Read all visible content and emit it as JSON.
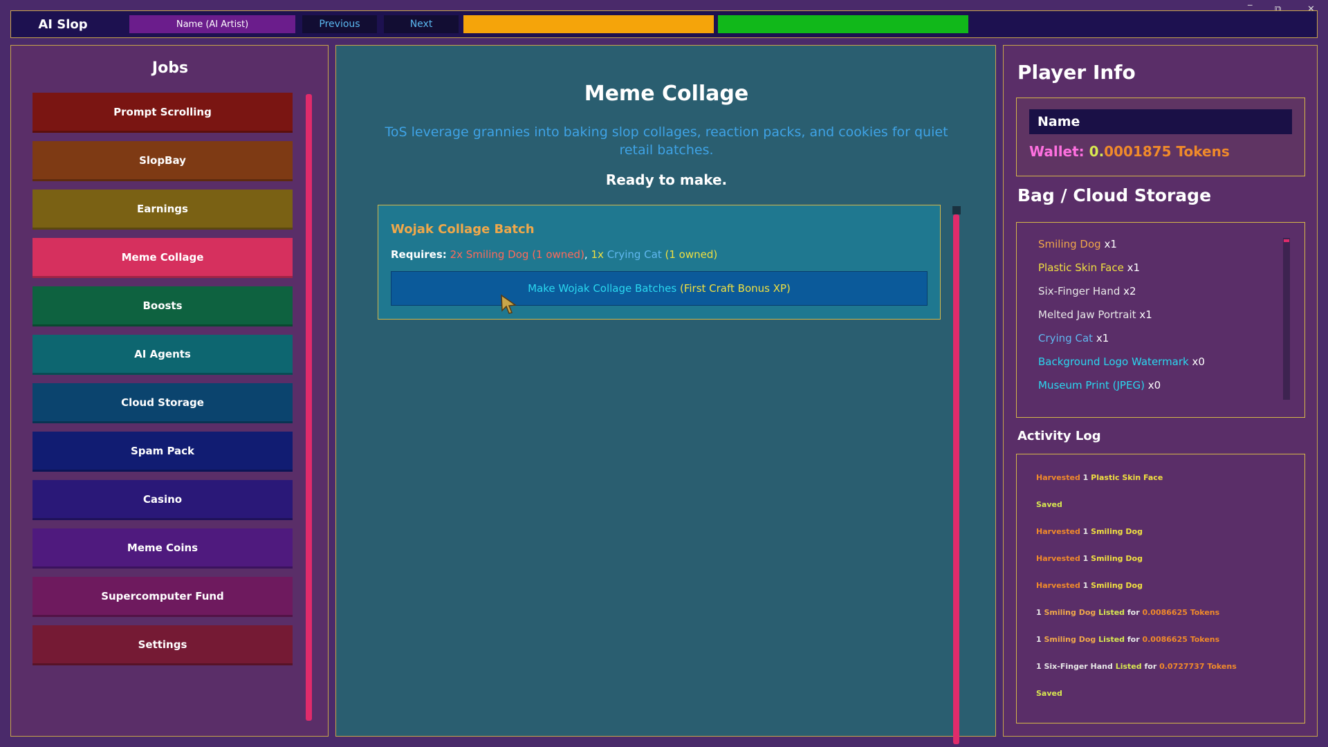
{
  "app": {
    "title": "AI Slop"
  },
  "topbar": {
    "name_tab": "Name (AI Artist)",
    "previous": "Previous",
    "next": "Next",
    "orange_bar_color": "#f5a40a",
    "green_bar_color": "#11b81a"
  },
  "window_controls": {
    "restore": "⧉",
    "close": "✕",
    "minimize": "‾"
  },
  "jobs": {
    "title": "Jobs",
    "items": [
      {
        "label": "Prompt Scrolling",
        "color": "#7a1512"
      },
      {
        "label": "SlopBay",
        "color": "#7e3a14"
      },
      {
        "label": "Earnings",
        "color": "#7a6114"
      },
      {
        "label": "Meme Collage",
        "color": "#d6305e"
      },
      {
        "label": "Boosts",
        "color": "#0e6240"
      },
      {
        "label": "AI Agents",
        "color": "#0d6670"
      },
      {
        "label": "Cloud Storage",
        "color": "#0b446e"
      },
      {
        "label": "Spam Pack",
        "color": "#111c72"
      },
      {
        "label": "Casino",
        "color": "#2a1878"
      },
      {
        "label": "Meme Coins",
        "color": "#4f1a7e"
      },
      {
        "label": "Supercomputer Fund",
        "color": "#6e1a5e"
      },
      {
        "label": "Settings",
        "color": "#751a34"
      }
    ]
  },
  "main": {
    "title": "Meme Collage",
    "description": "ToS leverage grannies into baking slop collages, reaction packs, and cookies for quiet retail batches.",
    "status": "Ready to make.",
    "recipe": {
      "title": "Wojak Collage Batch",
      "requires_label": "Requires:",
      "req1": "2x Smiling Dog (1 owned)",
      "sep": ",",
      "req2_qty": "1x",
      "req2_name": "Crying Cat",
      "req2_owned": "(1 owned)",
      "button_main": "Make Wojak Collage Batches",
      "button_bonus": "(First Craft Bonus XP)"
    }
  },
  "player": {
    "title": "Player Info",
    "name": "Name",
    "wallet_label": "Wallet:",
    "wallet_value": "0.",
    "wallet_amount": "0001875 Tokens"
  },
  "bag": {
    "title": "Bag / Cloud Storage",
    "items": [
      {
        "name": "Smiling Dog",
        "qty": "x1",
        "color": "#f0a84a"
      },
      {
        "name": "Plastic Skin Face",
        "qty": "x1",
        "color": "#f0e040"
      },
      {
        "name": "Six-Finger Hand",
        "qty": "x2",
        "color": "#e8e8e8"
      },
      {
        "name": "Melted Jaw Portrait",
        "qty": "x1",
        "color": "#e8e8e8"
      },
      {
        "name": "Crying Cat",
        "qty": "x1",
        "color": "#60b8f0"
      },
      {
        "name": "Background Logo Watermark",
        "qty": "x0",
        "color": "#2ad8f0"
      },
      {
        "name": "Museum Print (JPEG)",
        "qty": "x0",
        "color": "#2ad8f0"
      }
    ]
  },
  "log": {
    "title": "Activity Log",
    "lines": [
      {
        "a": "Harvested",
        "b": " 1 ",
        "c": "Plastic Skin Face",
        "type": "harvest"
      },
      {
        "a": "Saved",
        "type": "saved"
      },
      {
        "a": "Harvested",
        "b": " 1 ",
        "c": "Smiling Dog",
        "type": "harvest"
      },
      {
        "a": "Harvested",
        "b": " 1 ",
        "c": "Smiling Dog",
        "type": "harvest"
      },
      {
        "a": "Harvested",
        "b": " 1 ",
        "c": "Smiling Dog",
        "type": "harvest"
      },
      {
        "a": "1 ",
        "b": "Smiling Dog",
        "c": " Listed",
        "d": " for ",
        "e": "0.0086625 Tokens",
        "type": "listed"
      },
      {
        "a": "1 ",
        "b": "Smiling Dog",
        "c": " Listed",
        "d": " for ",
        "e": "0.0086625 Tokens",
        "type": "listed"
      },
      {
        "a": "1 ",
        "b": "Six-Finger Hand",
        "c": " Listed",
        "d": " for ",
        "e": "0.0727737 Tokens",
        "type": "listed"
      },
      {
        "a": "Saved",
        "type": "saved"
      }
    ]
  }
}
